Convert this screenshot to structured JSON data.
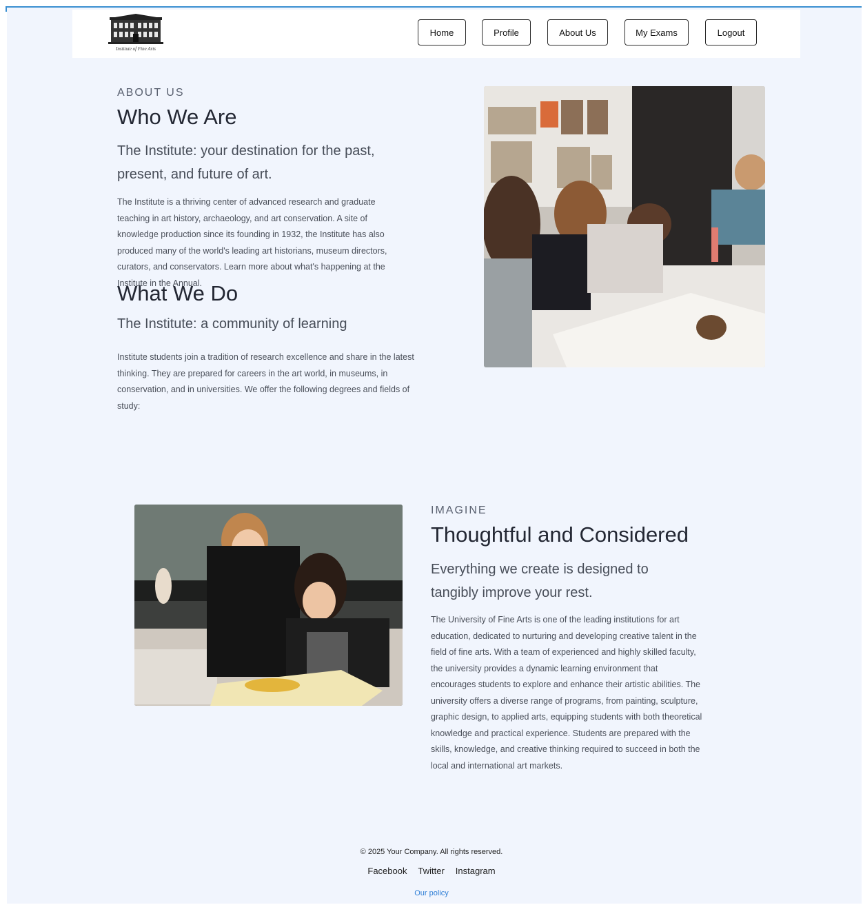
{
  "header": {
    "logo_caption": "Institute of Fine Arts",
    "nav": [
      "Home",
      "Profile",
      "About Us",
      "My Exams",
      "Logout"
    ]
  },
  "about": {
    "eyebrow": "ABOUT US",
    "who_title": "Who We Are",
    "who_lead": "The Institute: your destination for the past, present, and future of art.",
    "who_body": "The Institute is a thriving center of advanced research and graduate teaching in art history, archaeology, and art conservation. A site of knowledge production since its founding in 1932, the Institute has also produced many of the world's leading art historians, museum directors, curators, and conservators. Learn more about what's happening at the Institute in the Annual.",
    "what_title": "What We Do",
    "what_lead": "The Institute: a community of learning",
    "what_body": "Institute students join a tradition of research excellence and share in the latest thinking. They are prepared for careers in the art world, in museums, in conservation, and in universities. We offer the following degrees and fields of study:"
  },
  "imagine": {
    "eyebrow": "IMAGINE",
    "title": "Thoughtful and Considered",
    "lead": "Everything we create is designed to tangibly improve your rest.",
    "body": "The University of Fine Arts is one of the leading institutions for art education, dedicated to nurturing and developing creative talent in the field of fine arts. With a team of experienced and highly skilled faculty, the university provides a dynamic learning environment that encourages students to explore and enhance their artistic abilities. The university offers a diverse range of programs, from painting, sculpture, graphic design, to applied arts, equipping students with both theoretical knowledge and practical experience. Students are prepared with the skills, knowledge, and creative thinking required to succeed in both the local and international art markets."
  },
  "footer": {
    "copyright": "© 2025 Your Company. All rights reserved.",
    "links": [
      "Facebook",
      "Twitter",
      "Instagram"
    ],
    "policy": "Our policy"
  },
  "colors": {
    "page_bg": "#f1f5fd",
    "accent_border": "#3a8fd1",
    "link": "#2f7fd6"
  }
}
